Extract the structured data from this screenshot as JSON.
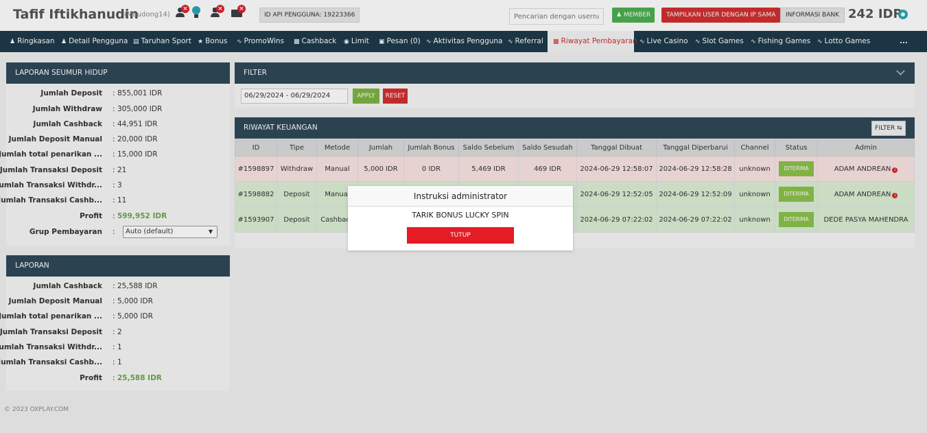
{
  "header": {
    "user_name": "Tafif Iftikhanudin",
    "user_login": "(Maudong14)",
    "api_id": "ID API PENGGUNA: 19223366",
    "search_placeholder": "Pencarian dengan userna",
    "member_label": "MEMBER",
    "same_ip_label": "TAMPILKAN USER DENGAN IP SAMA",
    "bank_info_label": "INFORMASI BANK",
    "balance": "242 IDR"
  },
  "nav": [
    {
      "label": "Ringkasan",
      "icon": "user-icon"
    },
    {
      "label": "Detail Pengguna",
      "icon": "user-icon"
    },
    {
      "label": "Taruhan Sport",
      "icon": "list-icon"
    },
    {
      "label": "Bonus",
      "icon": "star-icon"
    },
    {
      "label": "PromoWins",
      "icon": "pulse-icon"
    },
    {
      "label": "Cashback",
      "icon": "gift-icon"
    },
    {
      "label": "Limit",
      "icon": "gauge-icon"
    },
    {
      "label": "Pesan (0)",
      "icon": "chat-icon"
    },
    {
      "label": "Aktivitas Pengguna",
      "icon": "pulse-icon"
    },
    {
      "label": "Referral",
      "icon": "pulse-icon"
    },
    {
      "label": "Riwayat Pembayaran",
      "icon": "bar-chart-icon"
    },
    {
      "label": "Live Casino",
      "icon": "pulse-icon"
    },
    {
      "label": "Slot Games",
      "icon": "pulse-icon"
    },
    {
      "label": "Fishing Games",
      "icon": "pulse-icon"
    },
    {
      "label": "Lotto Games",
      "icon": "pulse-icon"
    },
    {
      "label": "...",
      "icon": ""
    }
  ],
  "lifetime": {
    "title": "LAPORAN SEUMUR HIDUP",
    "rows": [
      {
        "label": "Jumlah Deposit",
        "value": "855,001 IDR"
      },
      {
        "label": "Jumlah Withdraw",
        "value": "305,000 IDR"
      },
      {
        "label": "Jumlah Cashback",
        "value": "44,951 IDR"
      },
      {
        "label": "Jumlah Deposit Manual",
        "value": "20,000 IDR"
      },
      {
        "label": "Jumlah total penarikan ...",
        "value": "15,000 IDR"
      },
      {
        "label": "Jumlah Transaksi Deposit",
        "value": "21"
      },
      {
        "label": "Jumlah Transaksi Withdr...",
        "value": "3"
      },
      {
        "label": "Jumlah Transaksi Cashb...",
        "value": "11"
      },
      {
        "label": "Profit",
        "value": "599,952 IDR"
      }
    ],
    "payment_group_label": "Grup Pembayaran",
    "payment_group_value": "Auto (default)"
  },
  "report": {
    "title": "LAPORAN",
    "rows": [
      {
        "label": "Jumlah Cashback",
        "value": "25,588 IDR"
      },
      {
        "label": "Jumlah Deposit Manual",
        "value": "5,000 IDR"
      },
      {
        "label": "Jumlah total penarikan ...",
        "value": "5,000 IDR"
      },
      {
        "label": "Jumlah Transaksi Deposit",
        "value": "2"
      },
      {
        "label": "Jumlah Transaksi Withdr...",
        "value": "1"
      },
      {
        "label": "Jumlah Transaksi Cashb...",
        "value": "1"
      },
      {
        "label": "Profit",
        "value": "25,588 IDR"
      }
    ]
  },
  "filter": {
    "title": "FILTER",
    "date_range": "06/29/2024 - 06/29/2024",
    "apply_label": "APPLY",
    "reset_label": "RESET"
  },
  "history": {
    "title": "RIWAYAT KEUANGAN",
    "filter_button": "FILTER ⇆",
    "columns": [
      "ID",
      "Tipe",
      "Metode",
      "Jumlah",
      "Jumlah Bonus",
      "Saldo Sebelum",
      "Saldo Sesudah",
      "Tanggal Dibuat",
      "Tanggal Diperbarui",
      "Channel",
      "Status",
      "Admin"
    ],
    "rows": [
      {
        "id": "#1598897",
        "type": "Withdraw",
        "method": "Manual",
        "amount": "5,000 IDR",
        "bonus": "0 IDR",
        "before": "5,469 IDR",
        "after": "469 IDR",
        "created": "2024-06-29 12:58:07",
        "updated": "2024-06-29 12:58:28",
        "channel": "unknown",
        "status": "DITERIMA",
        "admin": "ADAM ANDREAN"
      },
      {
        "id": "#1598882",
        "type": "Deposit",
        "method": "Manual",
        "amount": "",
        "bonus": "",
        "before": "",
        "after": "",
        "created": "2024-06-29 12:52:05",
        "updated": "2024-06-29 12:52:09",
        "channel": "unknown",
        "status": "DITERIMA",
        "admin": "ADAM ANDREAN"
      },
      {
        "id": "#1593907",
        "type": "Deposit",
        "method": "Cashback",
        "amount": "",
        "bonus": "",
        "before": "",
        "after": "",
        "created": "2024-06-29 07:22:02",
        "updated": "2024-06-29 07:22:02",
        "channel": "unknown",
        "status": "DITERIMA",
        "admin": "DEDE PASYA MAHENDRA"
      }
    ]
  },
  "footer": "© 2023 OXPLAY.COM",
  "modal": {
    "title": "Instruksi administrator",
    "message": "TARIK BONUS LUCKY SPIN",
    "button": "TUTUP"
  }
}
